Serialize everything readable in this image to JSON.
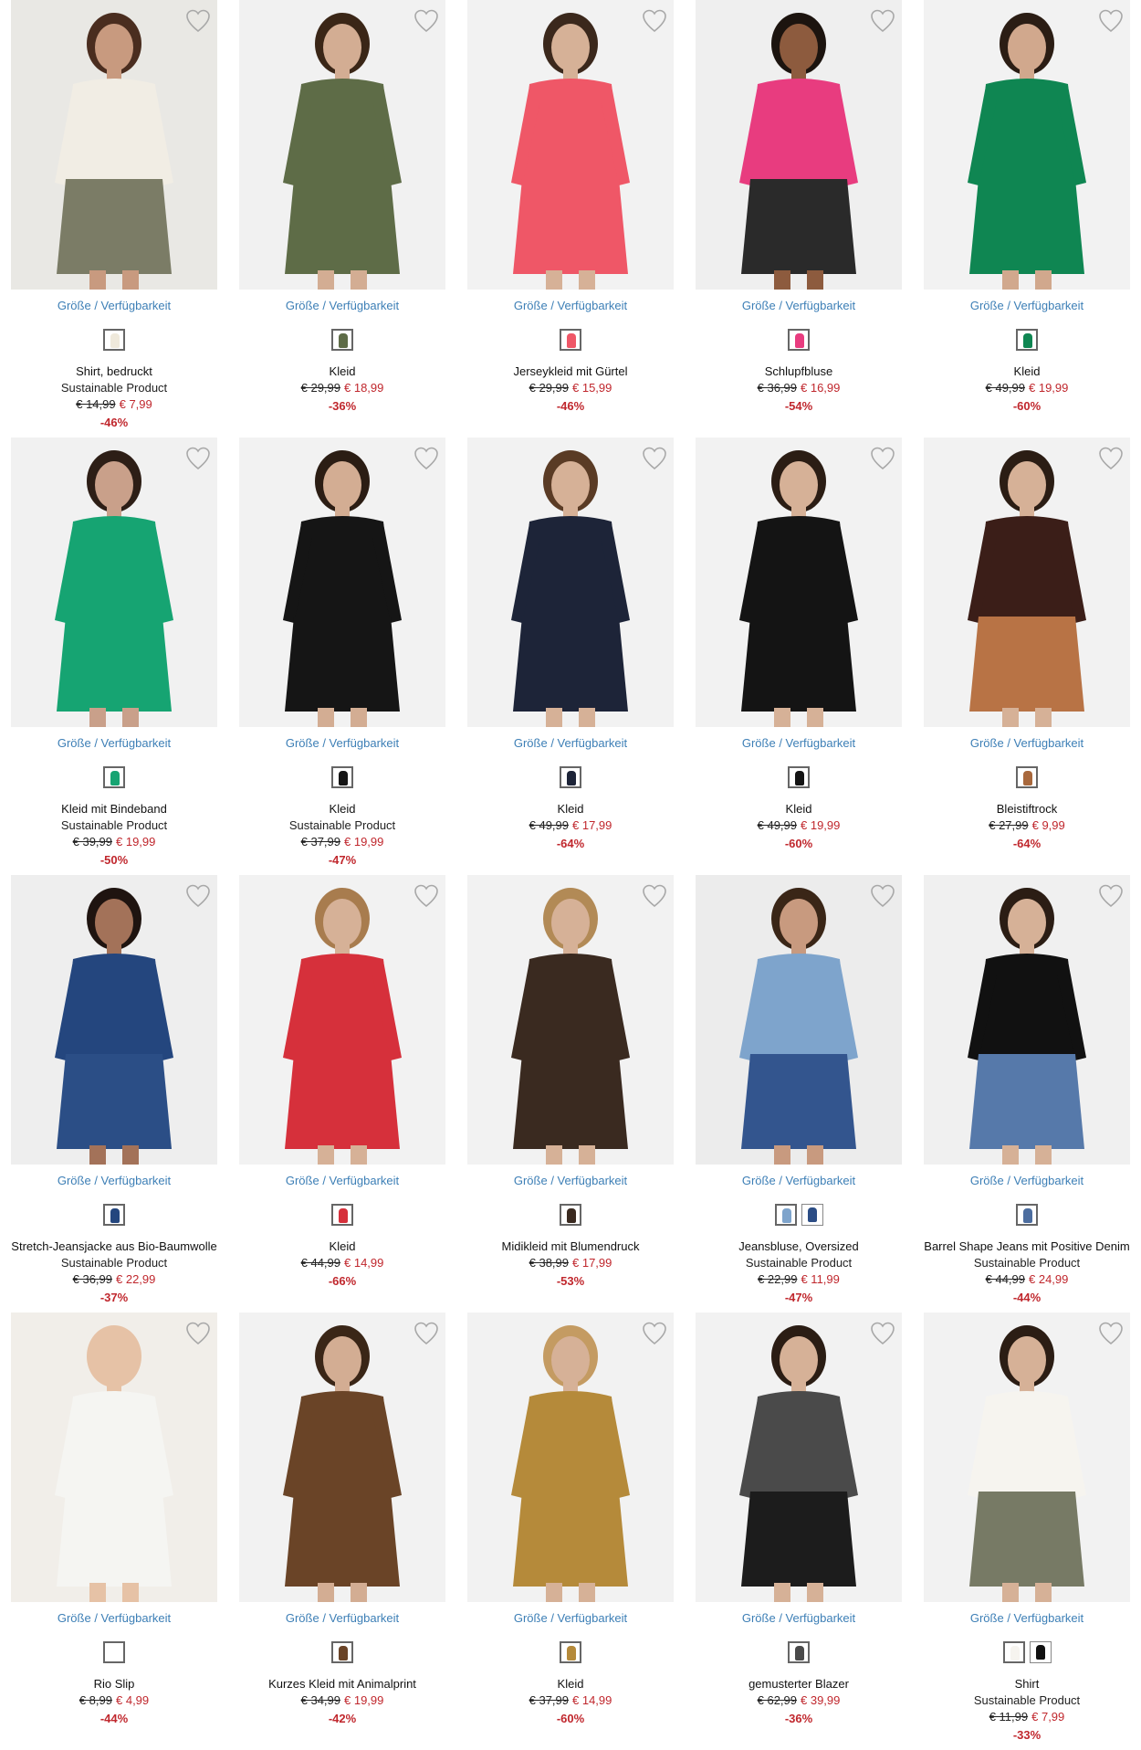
{
  "size_link_label": "Größe / Verfügbarkeit",
  "colors": {
    "price_red": "#c0272d",
    "link_blue": "#3d7fb6"
  },
  "products": [
    {
      "name": "Shirt, bedruckt",
      "subtitle": "Sustainable Product",
      "old_price": "€ 14,99",
      "new_price": "€ 7,99",
      "discount": "-46%",
      "bg": "#e9e8e4",
      "top": "#f1ede4",
      "bottom": "#7b7c66",
      "skin": "#c89a7f",
      "hair": "#4a2d1f",
      "swatches": [
        "#efe9db"
      ],
      "icon": "heart-icon"
    },
    {
      "name": "Kleid",
      "subtitle": "",
      "old_price": "€ 29,99",
      "new_price": "€ 18,99",
      "discount": "-36%",
      "bg": "#f1f1f1",
      "top": "#5e6c47",
      "bottom": "#5e6c47",
      "skin": "#d3ad93",
      "hair": "#3a2617",
      "swatches": [
        "#5e6c47"
      ],
      "icon": "heart-icon"
    },
    {
      "name": "Jerseykleid mit Gürtel",
      "subtitle": "",
      "old_price": "€ 29,99",
      "new_price": "€ 15,99",
      "discount": "-46%",
      "bg": "#f2f2f2",
      "top": "#ef5767",
      "bottom": "#ef5767",
      "skin": "#d6b197",
      "hair": "#3b281c",
      "swatches": [
        "#ef5767"
      ],
      "icon": "heart-icon"
    },
    {
      "name": "Schlupfbluse",
      "subtitle": "",
      "old_price": "€ 36,99",
      "new_price": "€ 16,99",
      "discount": "-54%",
      "bg": "#efefef",
      "top": "#e83c7f",
      "bottom": "#2a2a2a",
      "skin": "#8d5b3e",
      "hair": "#1c140f",
      "swatches": [
        "#e83c7f"
      ],
      "icon": "heart-icon"
    },
    {
      "name": "Kleid",
      "subtitle": "",
      "old_price": "€ 49,99",
      "new_price": "€ 19,99",
      "discount": "-60%",
      "bg": "#f2f2f2",
      "top": "#0f8652",
      "bottom": "#0f8652",
      "skin": "#d1a88d",
      "hair": "#2b1d14",
      "swatches": [
        "#0f8652"
      ],
      "icon": "heart-icon"
    },
    {
      "name": "Kleid mit Bindeband",
      "subtitle": "Sustainable Product",
      "old_price": "€ 39,99",
      "new_price": "€ 19,99",
      "discount": "-50%",
      "bg": "#f1f1f1",
      "top": "#16a472",
      "bottom": "#16a472",
      "skin": "#c9a08a",
      "hair": "#2d1e16",
      "swatches": [
        "#16a472"
      ],
      "icon": "heart-icon"
    },
    {
      "name": "Kleid",
      "subtitle": "Sustainable Product",
      "old_price": "€ 37,99",
      "new_price": "€ 19,99",
      "discount": "-47%",
      "bg": "#f2f2f2",
      "top": "#151515",
      "bottom": "#151515",
      "skin": "#d3ad93",
      "hair": "#2b1d14",
      "swatches": [
        "#151515"
      ],
      "icon": "heart-icon"
    },
    {
      "name": "Kleid",
      "subtitle": "",
      "old_price": "€ 49,99",
      "new_price": "€ 17,99",
      "discount": "-64%",
      "bg": "#f2f2f2",
      "top": "#1d2438",
      "bottom": "#1d2438",
      "skin": "#d6b197",
      "hair": "#5a3b25",
      "swatches": [
        "#1d2438"
      ],
      "icon": "heart-icon"
    },
    {
      "name": "Kleid",
      "subtitle": "",
      "old_price": "€ 49,99",
      "new_price": "€ 19,99",
      "discount": "-60%",
      "bg": "#f2f2f2",
      "top": "#141414",
      "bottom": "#141414",
      "skin": "#d6b197",
      "hair": "#2b1d14",
      "swatches": [
        "#141414"
      ],
      "icon": "heart-icon"
    },
    {
      "name": "Bleistiftrock",
      "subtitle": "",
      "old_price": "€ 27,99",
      "new_price": "€ 9,99",
      "discount": "-64%",
      "bg": "#f2f2f2",
      "top": "#3b1e18",
      "bottom": "#b87345",
      "skin": "#d6b197",
      "hair": "#2b1d14",
      "swatches": [
        "#a8683c"
      ],
      "icon": "heart-icon"
    },
    {
      "name": "Stretch-Jeansjacke aus Bio-Baumwolle",
      "subtitle": "Sustainable Product",
      "old_price": "€ 36,99",
      "new_price": "€ 22,99",
      "discount": "-37%",
      "bg": "#eeeeee",
      "top": "#24467e",
      "bottom": "#2b4e86",
      "skin": "#a37259",
      "hair": "#1f1410",
      "swatches": [
        "#24467e"
      ],
      "icon": "heart-icon"
    },
    {
      "name": "Kleid",
      "subtitle": "",
      "old_price": "€ 44,99",
      "new_price": "€ 14,99",
      "discount": "-66%",
      "bg": "#f2f2f2",
      "top": "#d6303b",
      "bottom": "#d6303b",
      "skin": "#d6b197",
      "hair": "#a87c4e",
      "swatches": [
        "#d6303b"
      ],
      "icon": "heart-icon"
    },
    {
      "name": "Midikleid mit Blumendruck",
      "subtitle": "",
      "old_price": "€ 38,99",
      "new_price": "€ 17,99",
      "discount": "-53%",
      "bg": "#f2f2f2",
      "top": "#3a2a20",
      "bottom": "#3a2a20",
      "skin": "#d6b197",
      "hair": "#b28a56",
      "swatches": [
        "#3a2a20"
      ],
      "icon": "heart-icon"
    },
    {
      "name": "Jeansbluse, Oversized",
      "subtitle": "Sustainable Product",
      "old_price": "€ 22,99",
      "new_price": "€ 11,99",
      "discount": "-47%",
      "bg": "#ececec",
      "top": "#7ea4cc",
      "bottom": "#33558e",
      "skin": "#c89a7f",
      "hair": "#3a2617",
      "swatches": [
        "#7ea4cc",
        "#2c4d85"
      ],
      "icon": "heart-icon"
    },
    {
      "name": "Barrel Shape Jeans mit Positive Denim",
      "subtitle": "Sustainable Product",
      "old_price": "€ 44,99",
      "new_price": "€ 24,99",
      "discount": "-44%",
      "bg": "#f0f0f0",
      "top": "#111111",
      "bottom": "#5679aa",
      "skin": "#d6b197",
      "hair": "#2b1d14",
      "swatches": [
        "#4c6d9f"
      ],
      "icon": "heart-icon"
    },
    {
      "name": "Rio Slip",
      "subtitle": "",
      "old_price": "€ 8,99",
      "new_price": "€ 4,99",
      "discount": "-44%",
      "bg": "#f1eee9",
      "top": "#f5f5f2",
      "bottom": "#f5f5f2",
      "skin": "#e6c2a6",
      "hair": "#e6c2a6",
      "swatches": [
        "#ffffff"
      ],
      "icon": "heart-icon"
    },
    {
      "name": "Kurzes Kleid mit Animalprint",
      "subtitle": "",
      "old_price": "€ 34,99",
      "new_price": "€ 19,99",
      "discount": "-42%",
      "bg": "#f2f2f2",
      "top": "#6a4427",
      "bottom": "#6a4427",
      "skin": "#d3ad93",
      "hair": "#3a2617",
      "swatches": [
        "#6a4427"
      ],
      "icon": "heart-icon"
    },
    {
      "name": "Kleid",
      "subtitle": "",
      "old_price": "€ 37,99",
      "new_price": "€ 14,99",
      "discount": "-60%",
      "bg": "#f2f2f2",
      "top": "#b58a3a",
      "bottom": "#b58a3a",
      "skin": "#d6b197",
      "hair": "#c49b62",
      "swatches": [
        "#b58a3a"
      ],
      "icon": "heart-icon"
    },
    {
      "name": "gemusterter Blazer",
      "subtitle": "",
      "old_price": "€ 62,99",
      "new_price": "€ 39,99",
      "discount": "-36%",
      "bg": "#f2f2f2",
      "top": "#4a4a4a",
      "bottom": "#1c1c1c",
      "skin": "#d6b197",
      "hair": "#2b1d14",
      "swatches": [
        "#4a4a4a"
      ],
      "icon": "heart-icon"
    },
    {
      "name": "Shirt",
      "subtitle": "Sustainable Product",
      "old_price": "€ 11,99",
      "new_price": "€ 7,99",
      "discount": "-33%",
      "bg": "#f2f2f2",
      "top": "#f6f4ef",
      "bottom": "#777a65",
      "skin": "#d6b197",
      "hair": "#2b1d14",
      "swatches": [
        "#f6f4ef",
        "#111111"
      ],
      "icon": "heart-icon"
    }
  ]
}
